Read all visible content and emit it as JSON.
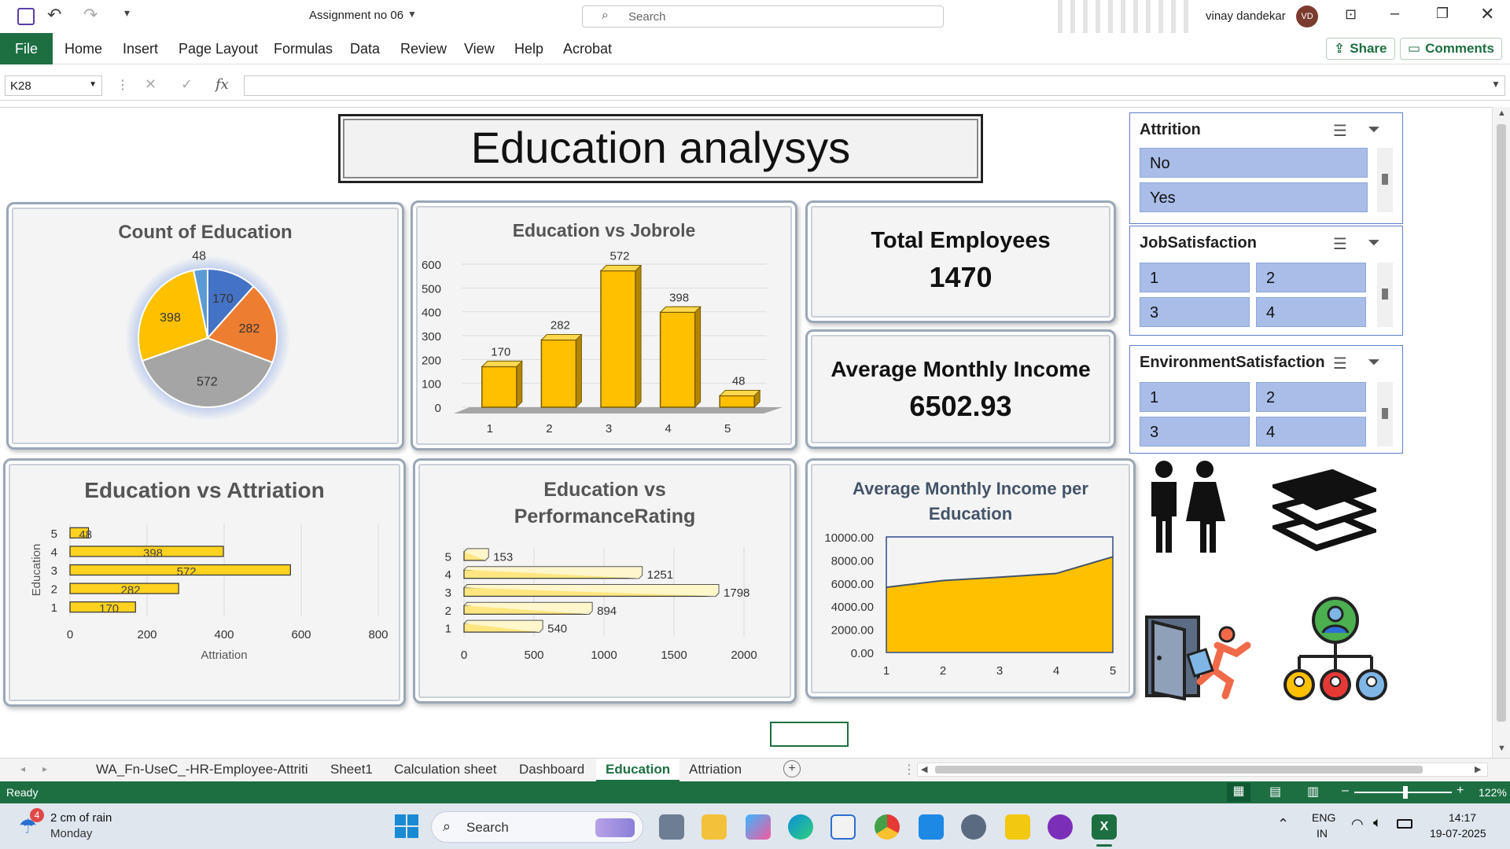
{
  "window": {
    "file_name": "Assignment no 06",
    "search_placeholder": "Search",
    "user_name": "vinay dandekar",
    "user_initials": "VD"
  },
  "ribbon": {
    "tabs": [
      "File",
      "Home",
      "Insert",
      "Page Layout",
      "Formulas",
      "Data",
      "Review",
      "View",
      "Help",
      "Acrobat"
    ],
    "share_label": "Share",
    "comments_label": "Comments"
  },
  "formula_bar": {
    "name_box": "K28",
    "fx": "fx",
    "value": ""
  },
  "dashboard": {
    "title": "Education analysys",
    "kpis": {
      "total_label": "Total Employees",
      "total_value": "1470",
      "income_label": "Average Monthly Income",
      "income_value": "6502.93"
    }
  },
  "slicers": [
    {
      "title": "Attrition",
      "items": [
        "No",
        "Yes"
      ]
    },
    {
      "title": "JobSatisfaction",
      "items": [
        "1",
        "2",
        "3",
        "4"
      ]
    },
    {
      "title": "EnvironmentSatisfaction",
      "items": [
        "1",
        "2",
        "3",
        "4"
      ]
    }
  ],
  "chart_data": [
    {
      "type": "pie",
      "title": "Count of Education",
      "categories": [
        "1",
        "2",
        "3",
        "4",
        "5"
      ],
      "values": [
        170,
        282,
        572,
        398,
        48
      ],
      "colors": [
        "#4472c4",
        "#ed7d31",
        "#a5a5a5",
        "#ffc000",
        "#5b9bd5"
      ]
    },
    {
      "type": "bar",
      "title": "Education vs Jobrole",
      "categories": [
        "1",
        "2",
        "3",
        "4",
        "5"
      ],
      "values": [
        170,
        282,
        572,
        398,
        48
      ],
      "ylim": [
        0,
        600
      ],
      "yticks": [
        "0",
        "100",
        "200",
        "300",
        "400",
        "500",
        "600"
      ],
      "color": "#ffc000"
    },
    {
      "type": "bar",
      "orientation": "horizontal",
      "title": "Education vs Attriation",
      "categories": [
        "1",
        "2",
        "3",
        "4",
        "5"
      ],
      "values": [
        170,
        282,
        572,
        398,
        48
      ],
      "xlabel": "Attriation",
      "ylabel": "Education",
      "xlim": [
        0,
        800
      ],
      "xticks": [
        "0",
        "200",
        "400",
        "600",
        "800"
      ],
      "color": "#ffd21f"
    },
    {
      "type": "bar",
      "orientation": "horizontal",
      "title": "Education vs PerformanceRating",
      "categories": [
        "1",
        "2",
        "3",
        "4",
        "5"
      ],
      "values": [
        540,
        894,
        1798,
        1251,
        153
      ],
      "xlim": [
        0,
        2000
      ],
      "xticks": [
        "0",
        "500",
        "1000",
        "1500",
        "2000"
      ],
      "color": "#ffe680"
    },
    {
      "type": "area",
      "title": "Average Monthly Income per Education",
      "categories": [
        "1",
        "2",
        "3",
        "4",
        "5"
      ],
      "values": [
        5640,
        6226,
        6517,
        6833,
        8278
      ],
      "ylim": [
        0,
        10000
      ],
      "yticks": [
        "0.00",
        "2000.00",
        "4000.00",
        "6000.00",
        "8000.00",
        "10000.00"
      ],
      "color": "#ffc000"
    }
  ],
  "sheet_tabs": [
    "WA_Fn-UseC_-HR-Employee-Attriti",
    "Sheet1",
    "Calculation sheet",
    "Dashboard",
    "Education",
    "Attriation"
  ],
  "active_sheet": "Education",
  "status": {
    "ready": "Ready",
    "zoom": "122%"
  },
  "taskbar": {
    "weather_badge": "4",
    "weather_text": "2 cm of rain",
    "weather_day": "Monday",
    "search_label": "Search",
    "lang1": "ENG",
    "lang2": "IN",
    "time": "14:17",
    "date": "19-07-2025"
  }
}
